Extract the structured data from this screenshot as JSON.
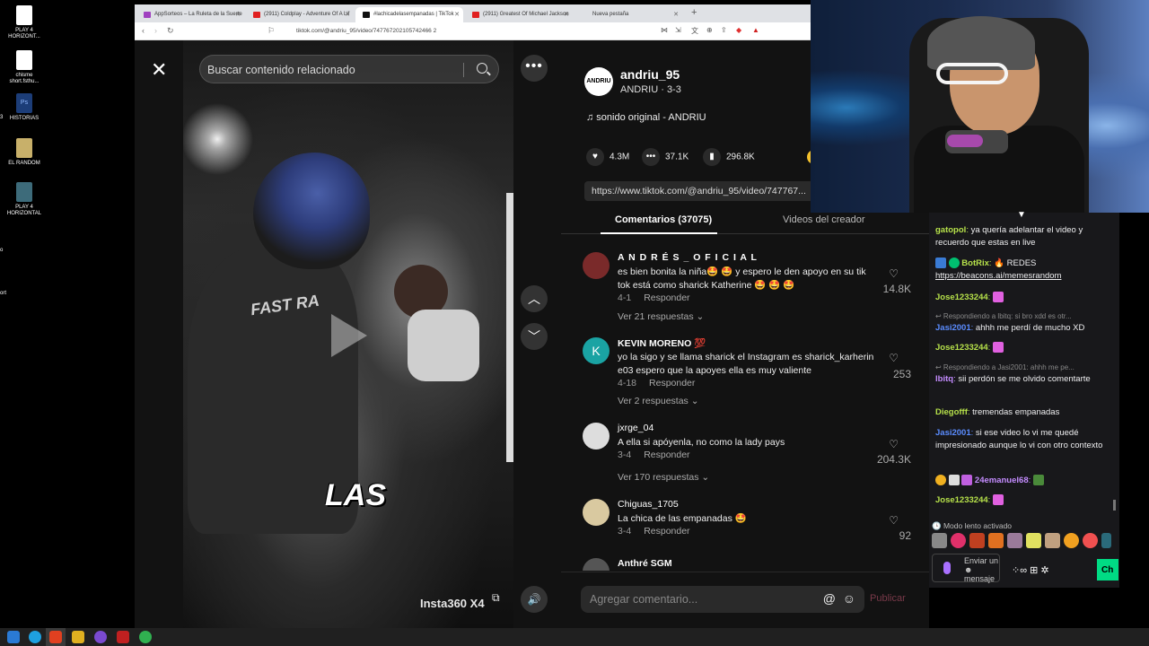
{
  "desktop": {
    "icons": [
      {
        "label": "PLAY 4 HORIZONT...",
        "color": "#ffffff"
      },
      {
        "label": "chisme short.fsthu...",
        "color": "#ffffff"
      },
      {
        "label": "HISTORIAS",
        "color": "#2a5ba8"
      },
      {
        "label": "EL RANDOM",
        "color": "#c8b06a"
      },
      {
        "label": "PLAY 4 HORIZONTAL",
        "color": "#3d6b7a"
      }
    ],
    "side_ticks": [
      "3",
      "o",
      "ort"
    ]
  },
  "browser": {
    "tabs": [
      {
        "label": "AppSorteos – La Ruleta de la Suerte",
        "favicon": "#a040c0"
      },
      {
        "label": "(2911) Coldplay - Adventure Of A Lif",
        "favicon": "#e02020"
      },
      {
        "label": "#lachicadelasempanadas | TikTok",
        "favicon": "#111111"
      },
      {
        "label": "(2911) Greatest Of Michael Jackson",
        "favicon": "#e02020"
      },
      {
        "label": "Nueva pestaña",
        "favicon": "#ffffff"
      }
    ],
    "new_tab": "+",
    "url": "tiktok.com/@andriu_95/video/747767202105742466 2"
  },
  "video": {
    "search_placeholder": "Buscar contenido relacionado",
    "jacket_text": "FAST   RA",
    "caption": "LAS",
    "watermark": "Insta360 X4",
    "close_icon": "✕",
    "more_icon": "•••",
    "up_icon": "︿",
    "down_icon": "﹀",
    "volume_icon": "🔊",
    "mini_icon": "⧉"
  },
  "panel": {
    "avatar_text": "ANDRIU",
    "username": "andriu_95",
    "subtitle": "ANDRIU · 3-3",
    "sound": "♫  sonido original - ANDRIU",
    "likes": "4.3M",
    "comments": "37.1K",
    "saves": "296.8K",
    "link": "https://www.tiktok.com/@andriu_95/video/747767...",
    "tab_comments": "Comentarios (37075)",
    "tab_creator": "Videos del creador",
    "comments_list": [
      {
        "name": "A N D R É S _ O F I C I A L",
        "text": "es bien bonita la niña🤩 🤩  y espero le den apoyo en su tik tok está como sharick Katherine 🤩 🤩 🤩",
        "date": "4-1",
        "reply": "Responder",
        "likes": "14.8K",
        "more": "Ver 21 respuestas  ⌄",
        "avatar_color": "#7a2a2a"
      },
      {
        "name": "KEVIN MORENO 💯",
        "text": "yo la sigo y se llama sharick el Instagram es sharick_karherin e03 espero que la apoyes ella es muy valiente",
        "date": "4-18",
        "reply": "Responder",
        "likes": "253",
        "more": "Ver 2 respuestas  ⌄",
        "avatar_color": "#1aa3a3",
        "avatar_letter": "K"
      },
      {
        "name": "jxrge_04",
        "text": "A ella si apóyenla, no como la lady pays",
        "date": "3-4",
        "reply": "Responder",
        "likes": "204.3K",
        "more": "Ver 170 respuestas  ⌄",
        "avatar_color": "#dddddd"
      },
      {
        "name": "Chiguas_1705",
        "text": "La chica de las empanadas 🤩",
        "date": "3-4",
        "reply": "Responder",
        "likes": "92",
        "avatar_color": "#d9c9a0"
      },
      {
        "name": "Anthré SGM",
        "avatar_color": "#555555"
      }
    ],
    "add_comment_placeholder": "Agregar comentario...",
    "at_icon": "@",
    "emoji_icon": "☺",
    "publish": "Publicar"
  },
  "chat": {
    "messages": [
      {
        "user": "gatopol",
        "user_color": "#b6e14a",
        "text": " ya quería adelantar el video y recuerdo que estas en live"
      },
      {
        "user": "BotRix",
        "user_color": "#b6e14a",
        "text": " 🔥 REDES",
        "link": "https://beacons.ai/memesrandom"
      },
      {
        "user": "Jose1233244",
        "user_color": "#b6e14a",
        "text": ""
      },
      {
        "reply": "↩ Respondiendo a lbitq: si bro xdd es otr..."
      },
      {
        "user": "Jasi2001",
        "user_color": "#5a8cff",
        "text": " ahhh me perdí de mucho XD"
      },
      {
        "user": "Jose1233244",
        "user_color": "#b6e14a",
        "text": ""
      },
      {
        "reply": "↩ Respondiendo a Jasi2001: ahhh me pe..."
      },
      {
        "user": "lbitq",
        "user_color": "#c48cff",
        "text": " sii perdón se me olvido comentarte"
      },
      {
        "user": "Diegofff",
        "user_color": "#b6e14a",
        "text": " tremendas empanadas"
      },
      {
        "user": "Jasi2001",
        "user_color": "#5a8cff",
        "text": " si ese video lo vi me quedé impresionado aunque lo vi con otro contexto"
      },
      {
        "user": "24emanuel68",
        "user_color": "#c48cff",
        "text": ""
      },
      {
        "user": "Jose1233244",
        "user_color": "#b6e14a",
        "text": ""
      }
    ],
    "slow_mode": "🕒 Modo lento activado",
    "input_placeholder": "Enviar un ☻ mensaje",
    "icons": "⁘∞   ⊞   ✲",
    "chat_button": "Ch"
  }
}
